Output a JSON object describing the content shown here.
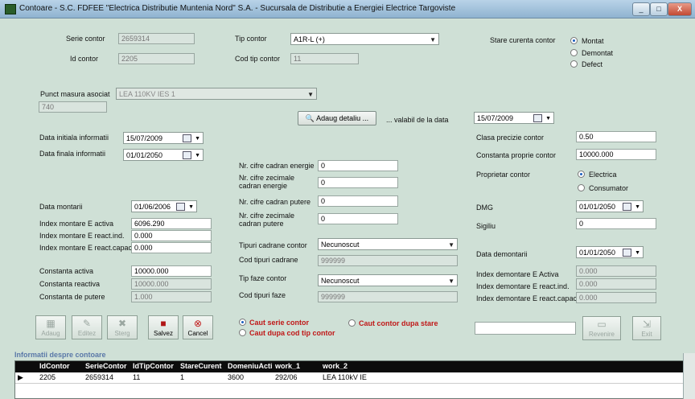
{
  "window": {
    "title": "Contoare - S.C. FDFEE \"Electrica Distributie Muntenia Nord\" S.A. - Sucursala de Distributie a Energiei Electrice Targoviste",
    "minimize": "_",
    "maximize": "□",
    "close": "X"
  },
  "header": {
    "serie_contor_label": "Serie contor",
    "serie_contor": "2659314",
    "id_contor_label": "Id contor",
    "id_contor": "2205",
    "tip_contor_label": "Tip contor",
    "tip_contor": "A1R-L (+)",
    "cod_tip_contor_label": "Cod tip contor",
    "cod_tip_contor": "11",
    "stare_label": "Stare curenta contor",
    "stare_options": [
      "Montat",
      "Demontat",
      "Defect"
    ]
  },
  "punct": {
    "label": "Punct masura asociat",
    "value": "LEA 110KV IES 1",
    "code": "740",
    "adaug_detaliu": "Adaug detaliu ...",
    "valabil_label": "... valabil de la data",
    "valabil_date": "15/07/2009"
  },
  "left": {
    "data_initiala_label": "Data initiala informatii",
    "data_initiala": "15/07/2009",
    "data_finala_label": "Data finala informatii",
    "data_finala": "01/01/2050",
    "data_montarii_label": "Data montarii",
    "data_montarii": "01/06/2006",
    "index_activa_label": "Index montare E activa",
    "index_activa": "6096.290",
    "index_reactind_label": "Index montare E react.ind.",
    "index_reactind": "0.000",
    "index_reactcap_label": "Index montare E react.capacit",
    "index_reactcap": "0.000",
    "const_activa_label": "Constanta activa",
    "const_activa": "10000.000",
    "const_reactiva_label": "Constanta reactiva",
    "const_reactiva": "10000.000",
    "const_putere_label": "Constanta de putere",
    "const_putere": "1.000"
  },
  "middle": {
    "cifre_energie_label": "Nr. cifre cadran energie",
    "cifre_energie": "0",
    "zecimale_energie_label_1": "Nr. cifre zecimale",
    "zecimale_energie_label_2": "cadran energie",
    "zecimale_energie": "0",
    "cifre_putere_label": "Nr. cifre cadran putere",
    "cifre_putere": "0",
    "zecimale_putere_label_1": "Nr. cifre zecimale",
    "zecimale_putere_label_2": "cadran putere",
    "zecimale_putere": "0",
    "tipuri_cadrane_label": "Tipuri cadrane contor",
    "tipuri_cadrane": "Necunoscut",
    "cod_tipuri_cadrane_label": "Cod tipuri cadrane",
    "cod_tipuri_cadrane": "999999",
    "tip_faze_label": "Tip faze contor",
    "tip_faze": "Necunoscut",
    "cod_tipuri_faze_label": "Cod tipuri faze",
    "cod_tipuri_faze": "999999"
  },
  "right": {
    "clasa_label": "Clasa precizie contor",
    "clasa": "0.50",
    "constanta_proprie_label": "Constanta proprie contor",
    "constanta_proprie": "10000.000",
    "proprietar_label": "Proprietar contor",
    "proprietar_options": [
      "Electrica",
      "Consumator"
    ],
    "dmg_label": "DMG",
    "dmg": "01/01/2050",
    "sigiliu_label": "Sigiliu",
    "sigiliu": "0",
    "data_demontarii_label": "Data demontarii",
    "data_demontarii": "01/01/2050",
    "idx_dem_activa_label": "Index demontare E Activa",
    "idx_dem_activa": "0.000",
    "idx_dem_reactind_label": "Index demontare E react.ind.",
    "idx_dem_reactind": "0.000",
    "idx_dem_reactcap_label": "Index demontare E react.capacit",
    "idx_dem_reactcap": "0.000"
  },
  "toolbar": {
    "adaug": "Adaug",
    "editez": "Editez",
    "sterg": "Sterg",
    "salvez": "Salvez",
    "cancel": "Cancel",
    "revenire": "Revenire",
    "exit": "Exit"
  },
  "search": {
    "caut_serie": "Caut serie contor",
    "caut_cod_tip": "Caut dupa cod tip contor",
    "caut_stare": "Caut contor dupa stare"
  },
  "grid": {
    "title": "Informatii despre contoare",
    "columns": [
      "IdContor",
      "SerieContor",
      "IdTipContor",
      "StareCurent",
      "DomeniuActi",
      "work_1",
      "work_2"
    ],
    "rows": [
      [
        "2205",
        "2659314",
        "11",
        "1",
        "3600",
        "292/06",
        "LEA 110kV IE"
      ]
    ]
  },
  "colors": {
    "background": "#cfe0d6",
    "accent_red": "#c01818",
    "grid_header": "#0c0c0c"
  }
}
